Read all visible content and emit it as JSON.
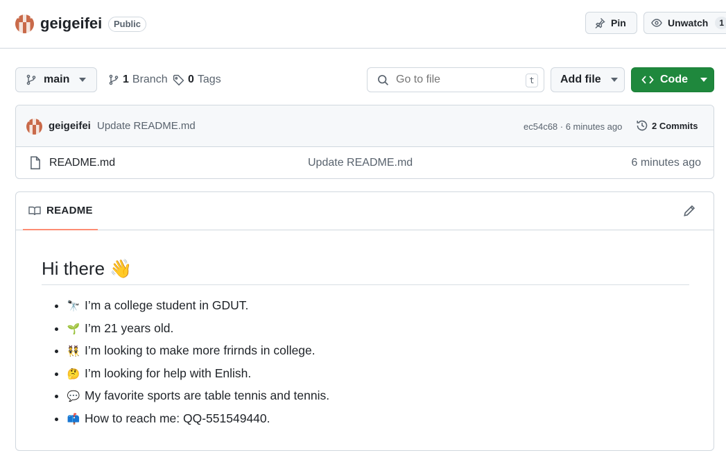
{
  "repo": {
    "name": "geigeifei",
    "visibility": "Public",
    "pin_label": "Pin",
    "watch_label": "Unwatch",
    "watch_count": "1"
  },
  "toolbar": {
    "branch": "main",
    "branches_count": "1",
    "branches_label": "Branch",
    "tags_count": "0",
    "tags_label": "Tags",
    "goto_placeholder": "Go to file",
    "goto_shortcut": "t",
    "add_file_label": "Add file",
    "code_label": "Code"
  },
  "latest_commit": {
    "author": "geigeifei",
    "message": "Update README.md",
    "meta": "ec54c68 · 6 minutes ago",
    "commits_label": "2 Commits"
  },
  "files": [
    {
      "name": "README.md",
      "commit": "Update README.md",
      "time": "6 minutes ago"
    }
  ],
  "readme": {
    "tab_label": "README",
    "heading": "Hi there 👋",
    "items": [
      {
        "emoji": "🔭",
        "text": "I’m a college student in GDUT."
      },
      {
        "emoji": "🌱",
        "text": "I’m 21 years old."
      },
      {
        "emoji": "👯",
        "text": "I’m looking to make more frirnds in college."
      },
      {
        "emoji": "🤔",
        "text": "I’m looking for help with Enlish."
      },
      {
        "emoji": "💬",
        "text": "My favorite sports are table tennis and tennis."
      },
      {
        "emoji": "📫",
        "text": "How to reach me: QQ-551549440."
      }
    ]
  },
  "colors": {
    "code_button": "#1f883d",
    "tab_underline": "#fd8c73",
    "border": "#d0d7de"
  }
}
